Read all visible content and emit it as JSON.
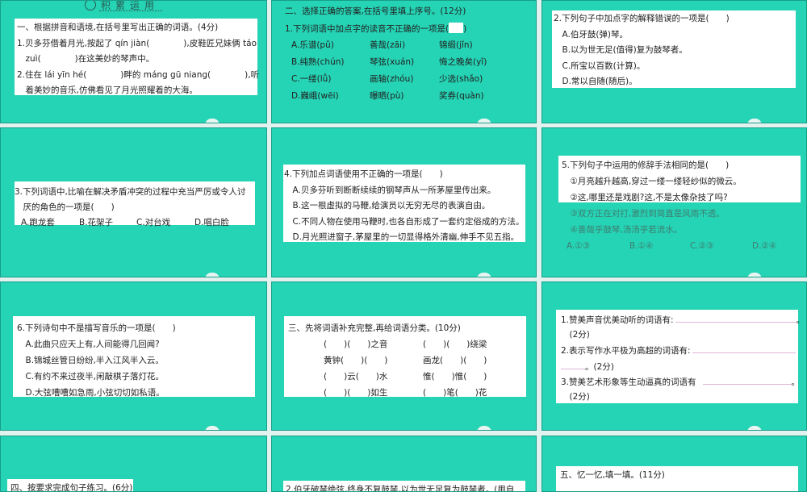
{
  "colors": {
    "slide_bg": "#25d3b5",
    "page_bg": "#e2f2ee",
    "box": "#ffffff"
  },
  "slides": [
    {
      "title": "积累运用",
      "lines": [
        "一、根据拼音和语境,在括号里写出正确的词语。(4分)",
        "1.贝多芬借着月光,按起了 qín jiàn(　　　　),皮鞋匠兄妹俩 táo",
        "　zuì(　　　　)在这美妙的琴声中。",
        "2.住在 lái yīn hé(　　　　)畔的 máng gū niang(　　　　),听",
        "　着美妙的音乐,仿佛看见了月光照耀着的大海。"
      ]
    },
    {
      "lines": [
        "二、选择正确的答案,在括号里填上序号。(12分)",
        "1.下列词语中加点字的读音不正确的一项是(",
        [
          "A.乐谱(pǔ)",
          "善哉(zāi)",
          "锦缎(jǐn)"
        ],
        [
          "B.纯熟(chún)",
          "琴弦(xuán)",
          "悔之晚矣(yǐ)"
        ],
        [
          "C.一缕(lǚ)",
          "画轴(zhóu)",
          "少选(shǎo)"
        ],
        [
          "D.巍峨(wēi)",
          "曝晒(pù)",
          "奖券(quàn)"
        ]
      ]
    },
    {
      "lines": [
        "2.下列句子中加点字的解释错误的一项是(　　)",
        "　A.伯牙鼓(弹)琴。",
        "　B.以为世无足(值得)复为鼓琴者。",
        "　C.所宝以百数(计算)。",
        "　D.常以自随(随后)。"
      ]
    },
    {
      "lines": [
        "3.下列词语中,比喻在解决矛盾冲突的过程中充当严厉或令人讨",
        "　厌的角色的一项是(　　)",
        [
          "A.跑龙套",
          "B.花架子",
          "C.对台戏",
          "D.唱白脸"
        ]
      ]
    },
    {
      "lines": [
        "4.下列加点词语使用不正确的一项是(　　)",
        "　A.贝多芬听到断断续续的钢琴声从一所茅屋里传出来。",
        "　B.这一根虚拟的马鞭,给演员以无穷无尽的表演自由。",
        "　C.不同人物在使用马鞭时,也各自形成了一套约定俗成的方法。",
        "　D.月光照进窗子,茅屋里的一切显得格外清幽,伸手不见五指。"
      ]
    },
    {
      "lines": [
        "5.下列句子中运用的修辞手法相同的是(　　)",
        "　①月亮越升越高,穿过一缕一缕轻纱似的微云。",
        "　②这,哪里还是戏剧?这,不是太像杂技了吗?",
        "　③双方正在对打,激烈到简直是风雨不透。",
        "　④善哉乎鼓琴,汤汤乎若流水。",
        [
          "A.①③",
          "B.①④",
          "C.②③",
          "D.②④"
        ]
      ]
    },
    {
      "lines": [
        "6.下列诗句中不是描写音乐的一项是(　　)",
        "　A.此曲只应天上有,人间能得几回闻?",
        "　B.锦城丝管日纷纷,半入江风半入云。",
        "　C.有约不来过夜半,闲敲棋子落灯花。",
        "　D.大弦嘈嘈如急雨,小弦切切如私语。"
      ]
    },
    {
      "lines": [
        "三、先将词语补充完整,再给词语分类。(10分)",
        [
          "(　　)(　　)之音",
          "(　　)(　　)绕梁"
        ],
        [
          "黄钟(　　)(　　)",
          "画龙(　　)(　　)"
        ],
        [
          "(　　)云(　　)水",
          "惟(　　)惟(　　)"
        ],
        [
          "(　　)(　　)如生",
          "(　　)笔(　　)花"
        ]
      ]
    },
    {
      "lines": [
        "1.赞美声音优美动听的词语有:",
        "　(2分)",
        "2.表示写作水平极为高超的词语有:",
        "。(2分)",
        "3.赞美艺术形象等生动逼真的词语有",
        "　(2分)"
      ],
      "period": "。"
    },
    {
      "lines": [
        "四、按要求完成句子练习。(6分)"
      ]
    },
    {
      "lines": [
        "2.伯牙破琴绝弦,终身不复鼓琴,以为世无足复为鼓琴者。(用自"
      ]
    },
    {
      "lines": [
        "五、忆一忆,填一填。(11分)"
      ]
    }
  ]
}
